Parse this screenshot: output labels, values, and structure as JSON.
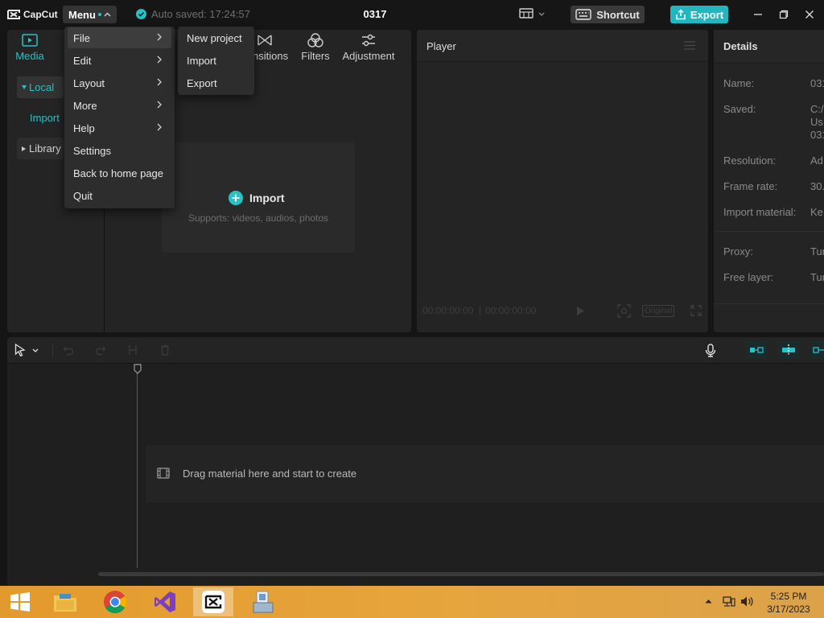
{
  "app": {
    "logo_text": "CapCut",
    "menu_label": "Menu",
    "autosave_text": "Auto saved: 17:24:57",
    "project_title": "0317",
    "shortcut_label": "Shortcut",
    "export_label": "Export"
  },
  "menu": {
    "items": [
      {
        "label": "File"
      },
      {
        "label": "Edit"
      },
      {
        "label": "Layout"
      },
      {
        "label": "More"
      },
      {
        "label": "Help"
      },
      {
        "label": "Settings"
      },
      {
        "label": "Back to home page"
      },
      {
        "label": "Quit"
      }
    ],
    "highlighted": "File",
    "submenu": [
      {
        "label": "New project"
      },
      {
        "label": "Import"
      },
      {
        "label": "Export"
      }
    ]
  },
  "media_panel": {
    "tabs": [
      {
        "label": "Media",
        "active": true
      },
      {
        "label": "nsitions"
      },
      {
        "label": "Filters"
      },
      {
        "label": "Adjustment"
      }
    ],
    "sidebar": [
      {
        "label": "Local"
      },
      {
        "label": "Import"
      },
      {
        "label": "Library"
      }
    ],
    "import_label": "Import",
    "import_hint": "Supports: videos, audios, photos"
  },
  "player": {
    "title": "Player",
    "time_current": "00:00:00:00",
    "time_total": "00:00:00:00",
    "ratio_label": "Original"
  },
  "details": {
    "title": "Details",
    "rows": [
      {
        "label": "Name:",
        "value": "031"
      },
      {
        "label": "Saved:",
        "value": "C:/\nUs\n031"
      },
      {
        "label": "Resolution:",
        "value": "Ad"
      },
      {
        "label": "Frame rate:",
        "value": "30."
      },
      {
        "label": "Import material:",
        "value": "Ke"
      },
      {
        "label": "Proxy:",
        "value": "Tur"
      },
      {
        "label": "Free layer:",
        "value": "Tur"
      }
    ]
  },
  "timeline": {
    "drop_hint": "Drag material here and start to create"
  },
  "taskbar": {
    "time": "5:25 PM",
    "date": "3/17/2023"
  },
  "colors": {
    "accent": "#27c1c6",
    "export_button": "#20b7c0",
    "taskbar": "#e39a2d"
  },
  "icons": [
    "capcut-logo-icon",
    "check-circle-icon",
    "layout-icon",
    "keyboard-icon",
    "export-icon",
    "minimize-icon",
    "maximize-icon",
    "close-icon",
    "media-icon",
    "transitions-icon",
    "filters-icon",
    "adjustment-icon",
    "plus-circle-icon",
    "play-icon",
    "fit-icon",
    "fullscreen-icon",
    "cursor-icon",
    "undo-icon",
    "redo-icon",
    "split-icon",
    "delete-icon",
    "mic-icon",
    "windows-start-icon",
    "file-explorer-icon",
    "chrome-icon",
    "visual-studio-icon",
    "capcut-icon",
    "app-icon"
  ]
}
